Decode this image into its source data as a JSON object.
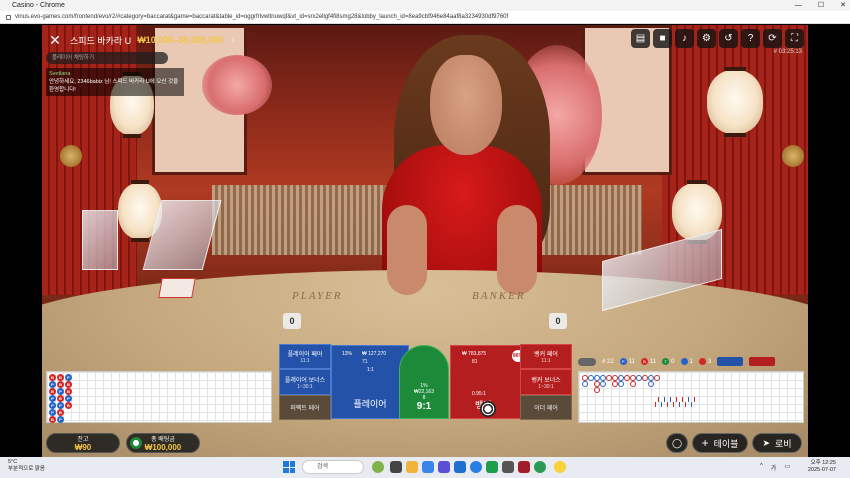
{
  "browser": {
    "window_title": "Casino - Chrome",
    "url": "vinus.evo-games.com/frontend/evo/r2/#category=baccarat&game=baccarat&table_id=oggrfrlvwltnuwqf&vt_id=srx2ellgf4fi8smg28&lobby_launch_id=8ea9cbf946e84aaf8a3234930df9760f",
    "controls": [
      "—",
      "☐",
      "✕"
    ]
  },
  "game": {
    "table_name": "스피드 바카라 U",
    "limits": "₩10,000–30,000,000",
    "round_id": "# 03:25:13",
    "top_icons": [
      "chat-icon",
      "video-icon",
      "sound-icon",
      "settings-icon",
      "history-icon",
      "help-icon",
      "refresh-icon",
      "fullscreen-icon"
    ],
    "chat": {
      "placeholder": "플레이어 채팅하기",
      "sender": "Svetlana",
      "message": "안녕하세요, 2346babiz 님! 스피드 바카라 U에 오신 것을 환영합니다!"
    },
    "table_print": {
      "player": "PLAYER",
      "banker": "BANKER"
    },
    "scores": {
      "player": "0",
      "banker": "0"
    }
  },
  "bets": {
    "player_pair": {
      "label": "플레이어 페어",
      "odds": "11:1"
    },
    "player_bonus": {
      "label": "플레이어 보너스",
      "odds": "1~30:1"
    },
    "perfect_pair": {
      "label": "퍼펙트 페어",
      "odds": ""
    },
    "player": {
      "label": "플레이어",
      "odds": "1:1",
      "pct": "13%",
      "amount": "₩ 127,270",
      "count": "71"
    },
    "tie": {
      "label": "9:1",
      "pct": "1%",
      "amount": "₩22,163",
      "count": "8"
    },
    "banker": {
      "label": "뱅커",
      "odds": "0.95:1",
      "pct": "86%",
      "amount": "₩ 783,875",
      "count": "81"
    },
    "banker_pair": {
      "label": "뱅커 페어",
      "odds": "11:1"
    },
    "banker_bonus": {
      "label": "뱅커 보너스",
      "odds": "1~30:1"
    },
    "either_pair": {
      "label": "이더 페어",
      "odds": ""
    }
  },
  "stats": {
    "total": "# 22",
    "player": "11",
    "banker": "11",
    "tie": "0",
    "player_pair": "1",
    "banker_pair": "3"
  },
  "bead_road": [
    [
      "B",
      "P",
      "B",
      "P",
      "P",
      "P",
      "B"
    ],
    [
      "B",
      "B",
      "P",
      "B",
      "P",
      "B",
      "P"
    ],
    [
      "P",
      "B",
      "B",
      "P",
      "B",
      "",
      ""
    ]
  ],
  "big_road": [
    [
      "B",
      "P",
      "P",
      "P",
      "B",
      "B",
      "P",
      "B",
      "B",
      "P",
      "B",
      "P",
      "B"
    ],
    [
      "P",
      "",
      "B",
      "P",
      "",
      "B",
      "P",
      "",
      "B",
      "",
      "",
      "P",
      ""
    ],
    [
      "",
      "",
      "B",
      "",
      "",
      "",
      "",
      "",
      "",
      "",
      "",
      "",
      ""
    ]
  ],
  "balance": {
    "label": "잔고",
    "value": "₩90"
  },
  "total_bet": {
    "label": "총 배팅금",
    "value": "₩100,000"
  },
  "actions": {
    "tables": "테이블",
    "lobby": "로비"
  },
  "taskbar": {
    "weather_temp": "5°C",
    "weather_desc": "부분적으로 맑음",
    "search": "검색",
    "time": "오후 12:25",
    "date": "2025-07-07",
    "lang": "가"
  },
  "colors": {
    "player": "#2452a8",
    "banker": "#b51e1e",
    "tie": "#1d8a3a",
    "accent": "#f4c542"
  }
}
